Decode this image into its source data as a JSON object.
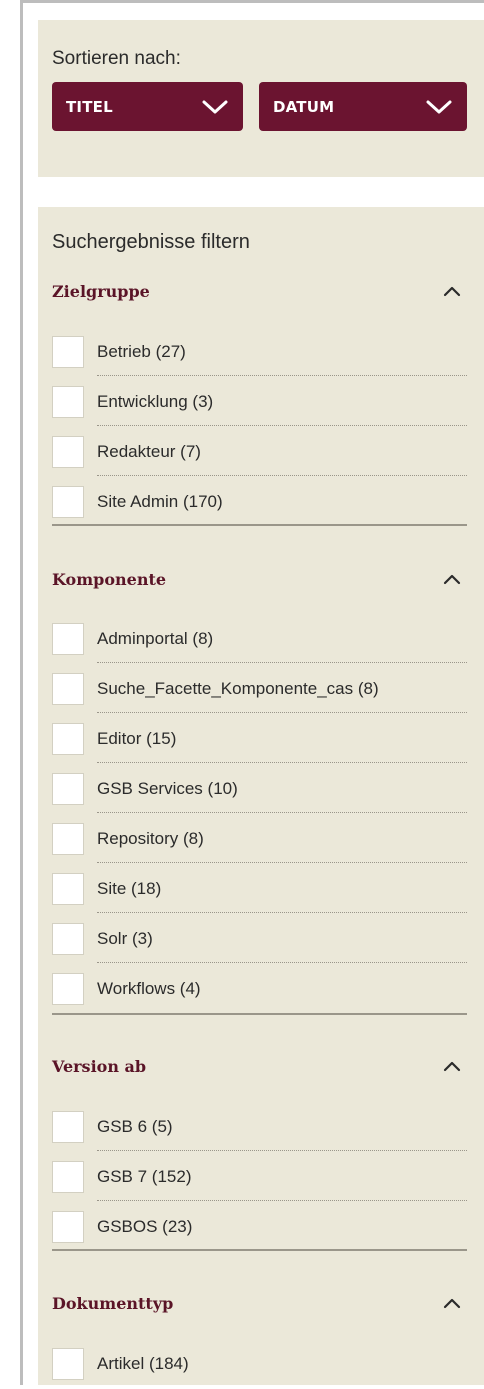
{
  "sort": {
    "label": "Sortieren nach:",
    "buttons": [
      {
        "label": "TITEL",
        "icon": "chevron-down-icon"
      },
      {
        "label": "DATUM",
        "icon": "chevron-down-icon"
      }
    ]
  },
  "filter": {
    "title": "Suchergebnisse filtern",
    "groups": [
      {
        "title": "Zielgruppe",
        "icon": "caret-up-icon",
        "items": [
          "Betrieb (27)",
          "Entwicklung (3)",
          "Redakteur (7)",
          "Site Admin (170)"
        ]
      },
      {
        "title": "Komponente",
        "icon": "caret-up-icon",
        "items": [
          "Adminportal (8)",
          "Suche_Facette_Komponente_cas (8)",
          "Editor (15)",
          "GSB Services (10)",
          "Repository (8)",
          "Site (18)",
          "Solr (3)",
          "Workflows (4)"
        ]
      },
      {
        "title": "Version ab",
        "icon": "caret-up-icon",
        "items": [
          "GSB 6 (5)",
          "GSB 7 (152)",
          "GSBOS (23)"
        ]
      },
      {
        "title": "Dokumenttyp",
        "icon": "caret-up-icon",
        "items": [
          "Artikel (184)"
        ]
      }
    ]
  },
  "colors": {
    "panel": "#ebe8d9",
    "button": "#6b1430",
    "heading": "#5a1427"
  }
}
